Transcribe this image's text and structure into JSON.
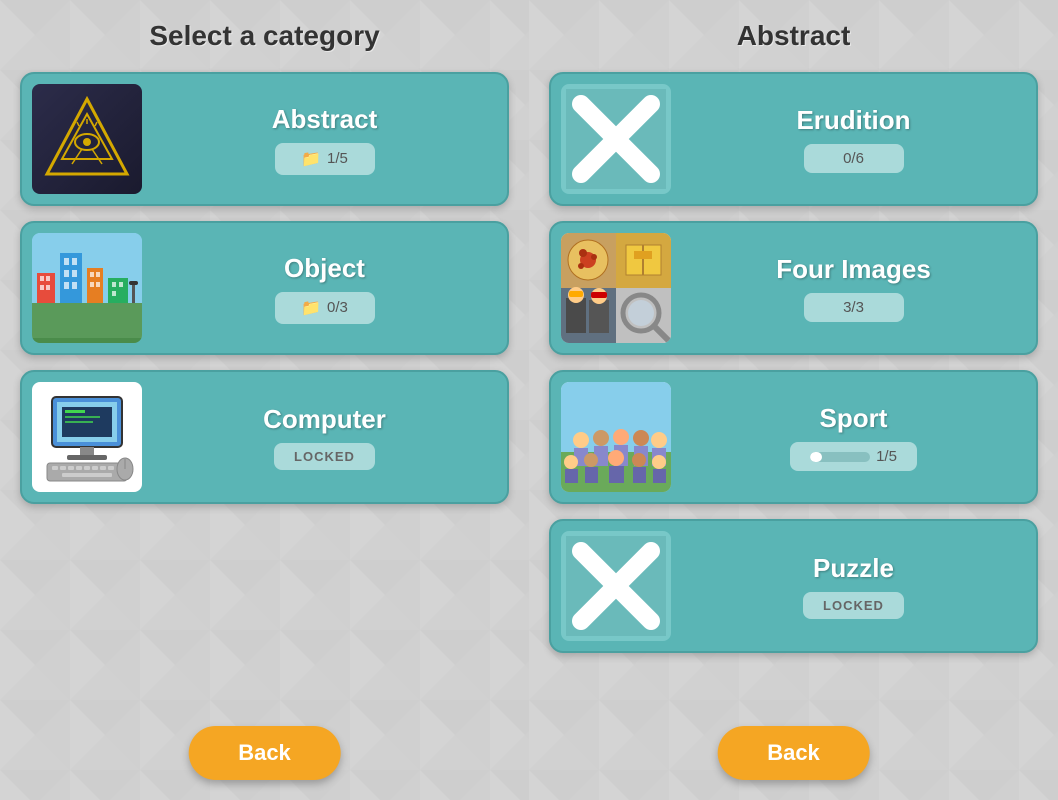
{
  "leftPanel": {
    "title": "Select a category",
    "categories": [
      {
        "id": "abstract",
        "name": "Abstract",
        "badge": "1/5",
        "badgeType": "progress",
        "progress": 20,
        "imageType": "abstract"
      },
      {
        "id": "object",
        "name": "Object",
        "badge": "0/3",
        "badgeType": "progress",
        "progress": 0,
        "imageType": "city"
      },
      {
        "id": "computer",
        "name": "Computer",
        "badge": "LOCKED",
        "badgeType": "locked",
        "progress": 0,
        "imageType": "computer"
      }
    ],
    "backLabel": "Back"
  },
  "rightPanel": {
    "title": "Abstract",
    "categories": [
      {
        "id": "erudition",
        "name": "Erudition",
        "badge": "0/6",
        "badgeType": "progress",
        "progress": 0,
        "imageType": "x"
      },
      {
        "id": "four-images",
        "name": "Four Images",
        "badge": "3/3",
        "badgeType": "progress",
        "progress": 100,
        "imageType": "four"
      },
      {
        "id": "sport",
        "name": "Sport",
        "badge": "1/5",
        "badgeType": "progress",
        "progress": 20,
        "imageType": "sport"
      },
      {
        "id": "puzzle",
        "name": "Puzzle",
        "badge": "LOCKED",
        "badgeType": "locked",
        "progress": 0,
        "imageType": "x"
      }
    ],
    "backLabel": "Back"
  },
  "divider": {
    "color": "#111111"
  }
}
